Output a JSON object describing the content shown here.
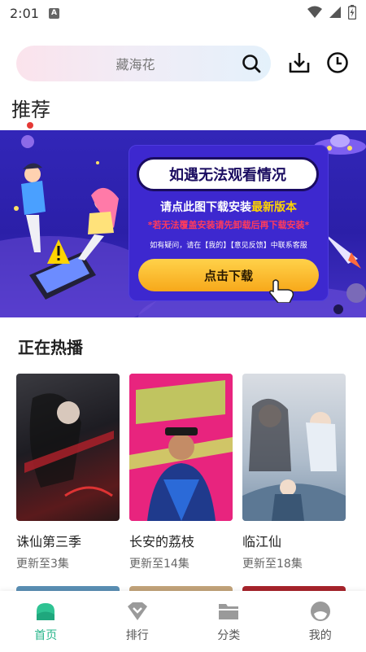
{
  "status_bar": {
    "time": "2:01",
    "notif_letter": "A",
    "icons": [
      "wifi-icon",
      "signal-icon",
      "battery-charging-icon"
    ]
  },
  "search": {
    "placeholder": "藏海花",
    "icon": "search-icon"
  },
  "header_actions": {
    "download_icon": "download-icon",
    "history_icon": "clock-icon"
  },
  "recommend": {
    "title": "推荐"
  },
  "banner": {
    "headline": "如遇无法观看情况",
    "line1_prefix": "请点此图下载安装",
    "line1_highlight": "最新版本",
    "line2": "*若无法覆盖安装请先卸载后再下载安装*",
    "line3": "如有疑问，请在【我的】【意见反馈】中联系客服",
    "button": "点击下载",
    "colors": {
      "background": "#3226b8",
      "button": "#f7b52a",
      "warning": "#ff3b5c",
      "highlight": "#ffd400"
    }
  },
  "now_playing": {
    "title": "正在热播",
    "items": [
      {
        "title": "诛仙第三季",
        "subtitle": "更新至3集"
      },
      {
        "title": "长安的荔枝",
        "subtitle": "更新至14集"
      },
      {
        "title": "临江仙",
        "subtitle": "更新至18集"
      }
    ]
  },
  "tab_bar": {
    "active_color": "#26b58a",
    "items": [
      {
        "label": "首页",
        "icon": "home-icon",
        "active": true
      },
      {
        "label": "排行",
        "icon": "ranking-icon",
        "active": false
      },
      {
        "label": "分类",
        "icon": "folder-icon",
        "active": false
      },
      {
        "label": "我的",
        "icon": "profile-icon",
        "active": false
      }
    ]
  }
}
